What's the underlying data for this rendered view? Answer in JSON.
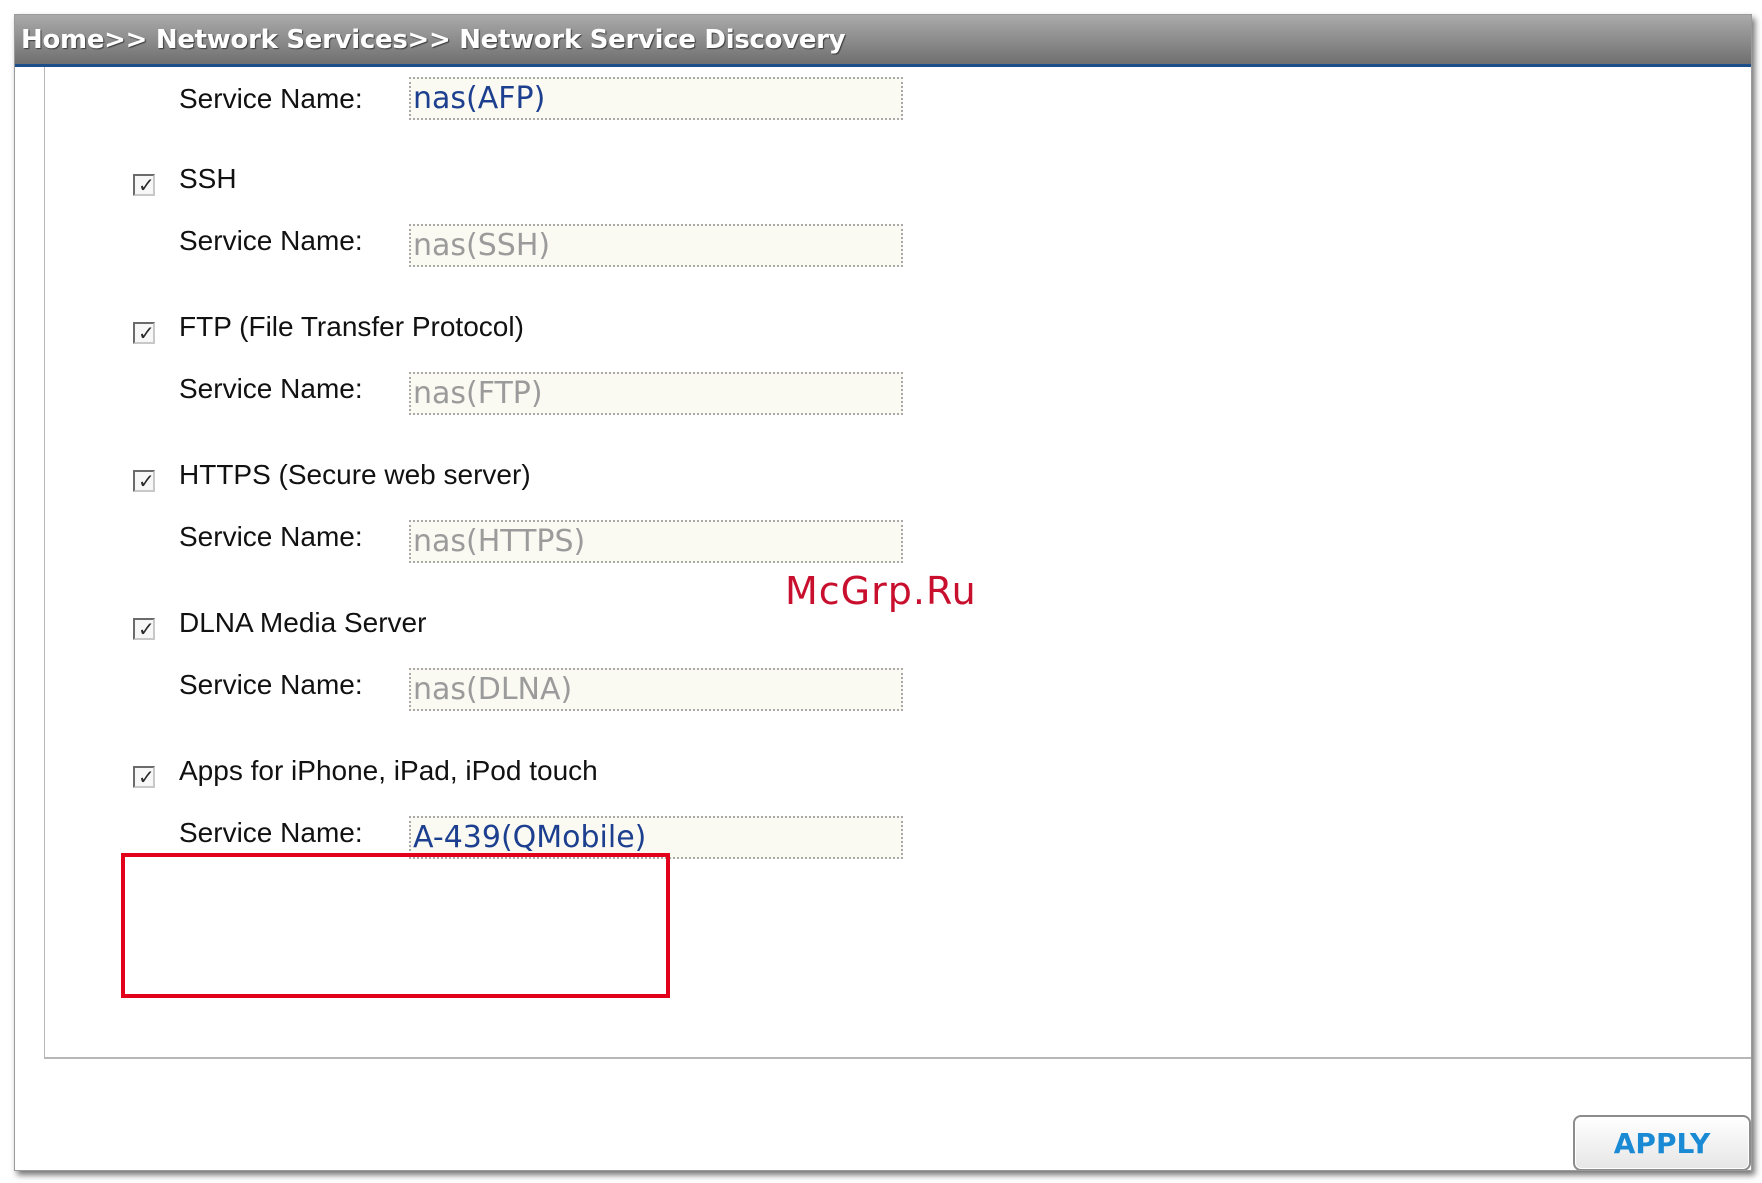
{
  "header": {
    "breadcrumb": "Home>> Network Services>> Network Service Discovery"
  },
  "form": {
    "service_name_label": "Service Name:",
    "afp": {
      "value": "nas(AFP)"
    },
    "ssh": {
      "label": "SSH",
      "checked": true,
      "value": "nas(SSH)"
    },
    "ftp": {
      "label": "FTP (File Transfer Protocol)",
      "checked": true,
      "value": "nas(FTP)"
    },
    "https": {
      "label": "HTTPS (Secure web server)",
      "checked": true,
      "value": "nas(HTTPS)"
    },
    "dlna": {
      "label": "DLNA Media Server",
      "checked": true,
      "value": "nas(DLNA)"
    },
    "apps": {
      "label": "Apps for iPhone, iPad, iPod touch",
      "checked": true,
      "value": "A-439(QMobile)"
    }
  },
  "watermark": "McGrp.Ru",
  "actions": {
    "apply_label": "APPLY"
  },
  "colors": {
    "active_text": "#1d3f8f",
    "disabled_text": "#9b9b9b",
    "highlight": "#e3001b",
    "apply_text": "#1a8ad4"
  },
  "icons": {
    "checkbox_mark": "✓"
  }
}
